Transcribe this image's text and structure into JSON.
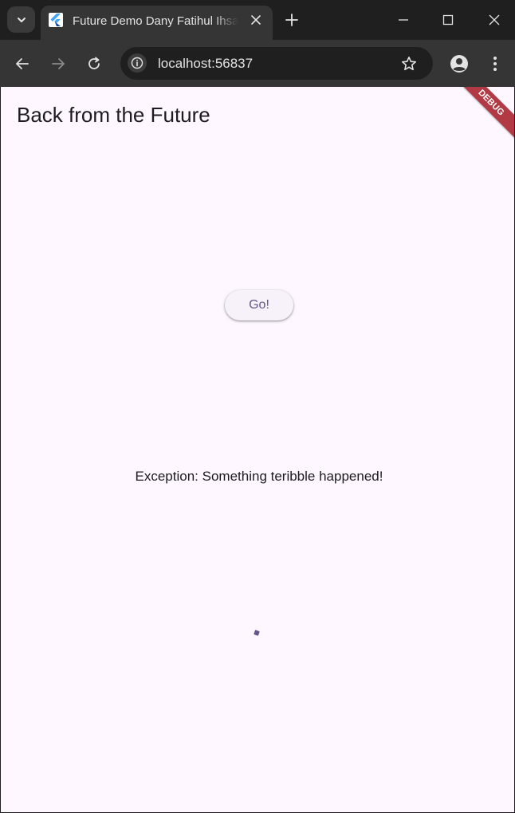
{
  "browser": {
    "tab_title": "Future Demo Dany Fatihul Ihsan",
    "url": "localhost:56837",
    "icons": {
      "tab_search": "chevron-down-icon",
      "favicon": "flutter-logo-icon",
      "tab_close": "close-icon",
      "new_tab": "plus-icon",
      "minimize": "minimize-icon",
      "maximize": "maximize-icon",
      "close_window": "close-icon",
      "back": "arrow-left-icon",
      "forward": "arrow-right-icon",
      "reload": "reload-icon",
      "site_info": "info-icon",
      "bookmark": "star-icon",
      "profile": "person-icon",
      "menu": "more-vertical-icon"
    }
  },
  "app": {
    "title": "Back from the Future",
    "debug_banner": "DEBUG",
    "go_button": "Go!",
    "result": "Exception: Something teribble happened!",
    "colors": {
      "background": "#fef7ff",
      "primary": "#65558f",
      "debug_banner": "#b13a44"
    }
  }
}
